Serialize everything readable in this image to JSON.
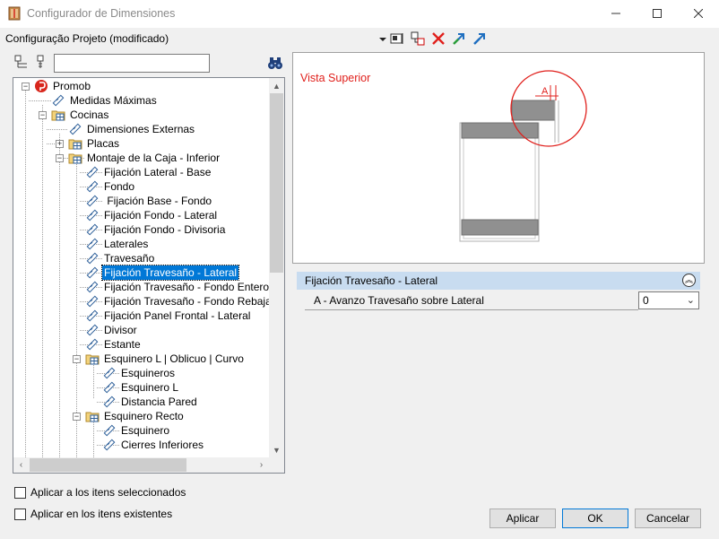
{
  "window": {
    "title": "Configurador de Dimensiones"
  },
  "toolbar": {
    "project_label": "Configuração Projeto (modificado)"
  },
  "search": {
    "value": "",
    "placeholder": ""
  },
  "tree": [
    {
      "label": "Promob"
    },
    {
      "label": "Medidas Máximas"
    },
    {
      "label": "Cocinas"
    },
    {
      "label": "Dimensiones Externas"
    },
    {
      "label": "Placas"
    },
    {
      "label": "Montaje de la Caja - Inferior"
    },
    {
      "label": "Fijación Lateral - Base"
    },
    {
      "label": "Fondo"
    },
    {
      "label": " Fijación Base - Fondo"
    },
    {
      "label": "Fijación Fondo - Lateral"
    },
    {
      "label": "Fijación Fondo - Divisoria"
    },
    {
      "label": "Laterales"
    },
    {
      "label": "Travesaño"
    },
    {
      "label": "Fijación Travesaño - Lateral",
      "selected": true
    },
    {
      "label": "Fijación Travesaño - Fondo Entero"
    },
    {
      "label": "Fijación Travesaño - Fondo Rebajado"
    },
    {
      "label": "Fijación Panel Frontal - Lateral"
    },
    {
      "label": "Divisor"
    },
    {
      "label": "Estante"
    },
    {
      "label": "Esquinero L | Oblicuo | Curvo"
    },
    {
      "label": "Esquineros"
    },
    {
      "label": "Esquinero L"
    },
    {
      "label": "Distancia Pared"
    },
    {
      "label": "Esquinero Recto"
    },
    {
      "label": "Esquinero"
    },
    {
      "label": "Cierres Inferiores"
    }
  ],
  "options": {
    "apply_selected": "Aplicar a los itens seleccionados",
    "apply_existing": "Aplicar en los itens existentes"
  },
  "preview": {
    "title": "Vista Superior",
    "dimension_letter": "A"
  },
  "properties": {
    "group_title": "Fijación Travesaño - Lateral",
    "rows": [
      {
        "label": "A - Avanzo Travesaño sobre Lateral",
        "value": "0"
      }
    ]
  },
  "buttons": {
    "apply": "Aplicar",
    "ok": "OK",
    "cancel": "Cancelar"
  },
  "colors": {
    "accent": "#0078d7",
    "view_title": "#e0201c",
    "group_header": "#c8dcf0"
  }
}
